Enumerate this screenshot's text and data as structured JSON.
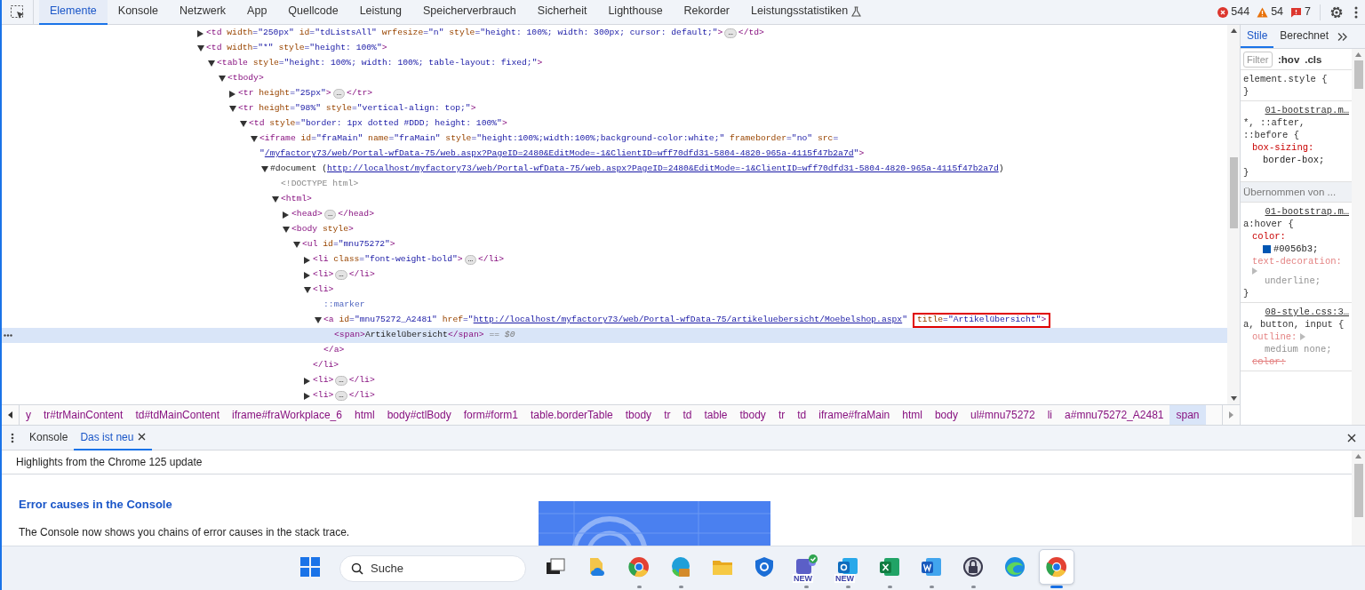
{
  "toolbar": {
    "tabs": [
      {
        "label": "Elemente",
        "selected": true,
        "experimental": false
      },
      {
        "label": "Konsole",
        "selected": false,
        "experimental": false
      },
      {
        "label": "Netzwerk",
        "selected": false,
        "experimental": false
      },
      {
        "label": "App",
        "selected": false,
        "experimental": false
      },
      {
        "label": "Quellcode",
        "selected": false,
        "experimental": false
      },
      {
        "label": "Leistung",
        "selected": false,
        "experimental": false
      },
      {
        "label": "Speicherverbrauch",
        "selected": false,
        "experimental": false
      },
      {
        "label": "Sicherheit",
        "selected": false,
        "experimental": false
      },
      {
        "label": "Lighthouse",
        "selected": false,
        "experimental": false
      },
      {
        "label": "Rekorder",
        "selected": false,
        "experimental": false
      },
      {
        "label": "Leistungsstatistiken",
        "selected": false,
        "experimental": true
      }
    ],
    "counts": [
      {
        "kind": "error",
        "text": "544"
      },
      {
        "kind": "warning",
        "text": "54"
      },
      {
        "kind": "issue",
        "text": "7"
      }
    ]
  },
  "dom_tree": {
    "nodes": [
      {
        "kind": "element",
        "expanded": false,
        "selected": false,
        "parts": [
          {
            "kind": "tag",
            "text": "<td"
          },
          {
            "kind": "attr",
            "text": " width"
          },
          {
            "kind": "value",
            "text": "=\"250px\""
          },
          {
            "kind": "attr",
            "text": " id"
          },
          {
            "kind": "value",
            "text": "=\"tdListsAll\""
          },
          {
            "kind": "attr",
            "text": " wrfesize"
          },
          {
            "kind": "value",
            "text": "=\"n\""
          },
          {
            "kind": "attr",
            "text": " style"
          },
          {
            "kind": "value",
            "text": "=\"height: 100%; width: 300px; cursor: default;\""
          },
          {
            "kind": "tag",
            "text": ">"
          },
          {
            "kind": "more",
            "text": "…"
          },
          {
            "kind": "tag",
            "text": "</td>"
          }
        ]
      },
      {
        "kind": "element",
        "expanded": true,
        "selected": false,
        "parts": [
          {
            "kind": "tag",
            "text": "<td"
          },
          {
            "kind": "attr",
            "text": " width"
          },
          {
            "kind": "value",
            "text": "=\"*\""
          },
          {
            "kind": "attr",
            "text": " style"
          },
          {
            "kind": "value",
            "text": "=\"height: 100%\""
          },
          {
            "kind": "tag",
            "text": ">"
          }
        ],
        "children": [
          {
            "kind": "element",
            "expanded": true,
            "selected": false,
            "parts": [
              {
                "kind": "tag",
                "text": "<table"
              },
              {
                "kind": "attr",
                "text": " style"
              },
              {
                "kind": "value",
                "text": "=\"height: 100%; width: 100%; table-layout: fixed;\""
              },
              {
                "kind": "tag",
                "text": ">"
              }
            ],
            "children": [
              {
                "kind": "element",
                "expanded": true,
                "selected": false,
                "parts": [
                  {
                    "kind": "tag",
                    "text": "<tbody>"
                  }
                ],
                "children": [
                  {
                    "kind": "element",
                    "expanded": false,
                    "selected": false,
                    "parts": [
                      {
                        "kind": "tag",
                        "text": "<tr"
                      },
                      {
                        "kind": "attr",
                        "text": " height"
                      },
                      {
                        "kind": "value",
                        "text": "=\"25px\""
                      },
                      {
                        "kind": "tag",
                        "text": ">"
                      },
                      {
                        "kind": "more",
                        "text": "…"
                      },
                      {
                        "kind": "tag",
                        "text": "</tr>"
                      }
                    ]
                  },
                  {
                    "kind": "element",
                    "expanded": true,
                    "selected": false,
                    "parts": [
                      {
                        "kind": "tag",
                        "text": "<tr"
                      },
                      {
                        "kind": "attr",
                        "text": " height"
                      },
                      {
                        "kind": "value",
                        "text": "=\"98%\""
                      },
                      {
                        "kind": "attr",
                        "text": " style"
                      },
                      {
                        "kind": "value",
                        "text": "=\"vertical-align: top;\""
                      },
                      {
                        "kind": "tag",
                        "text": ">"
                      }
                    ],
                    "children": [
                      {
                        "kind": "element",
                        "expanded": true,
                        "selected": false,
                        "parts": [
                          {
                            "kind": "tag",
                            "text": "<td"
                          },
                          {
                            "kind": "attr",
                            "text": " style"
                          },
                          {
                            "kind": "value",
                            "text": "=\"border: 1px dotted #DDD; height: 100%\""
                          },
                          {
                            "kind": "tag",
                            "text": ">"
                          }
                        ],
                        "children": [
                          {
                            "kind": "element",
                            "expanded": true,
                            "selected": false,
                            "parts": [
                              {
                                "kind": "tag",
                                "text": "<iframe"
                              },
                              {
                                "kind": "attr",
                                "text": " id"
                              },
                              {
                                "kind": "value",
                                "text": "=\"fraMain\""
                              },
                              {
                                "kind": "attr",
                                "text": " name"
                              },
                              {
                                "kind": "value",
                                "text": "=\"fraMain\""
                              },
                              {
                                "kind": "attr",
                                "text": " style"
                              },
                              {
                                "kind": "value",
                                "text": "=\"height:100%;width:100%;background-color:white;\""
                              },
                              {
                                "kind": "attr",
                                "text": " frameborder"
                              },
                              {
                                "kind": "value",
                                "text": "=\"no\""
                              },
                              {
                                "kind": "attr",
                                "text": " src"
                              },
                              {
                                "kind": "value",
                                "text": "="
                              }
                            ],
                            "continuation": [
                              {
                                "kind": "value",
                                "text": "\""
                              },
                              {
                                "kind": "link",
                                "text": "/myfactory73/web/Portal-wfData-75/web.aspx?PageID=2480&EditMode=-1&ClientID=wff70dfd31-5804-4820-965a-4115f47b2a7d"
                              },
                              {
                                "kind": "value",
                                "text": "\""
                              },
                              {
                                "kind": "tag",
                                "text": ">"
                              }
                            ],
                            "children": [
                              {
                                "kind": "element",
                                "expanded": true,
                                "selected": false,
                                "parts": [
                                  {
                                    "kind": "text",
                                    "text": "#document ("
                                  },
                                  {
                                    "kind": "link",
                                    "text": "http://localhost/myfactory73/web/Portal-wfData-75/web.aspx?PageID=2480&EditMode=-1&ClientID=wff70dfd31-5804-4820-965a-4115f47b2a7d"
                                  },
                                  {
                                    "kind": "text",
                                    "text": ")"
                                  }
                                ],
                                "children": [
                                  {
                                    "kind": "leaf",
                                    "expanded": false,
                                    "selected": false,
                                    "parts": [
                                      {
                                        "kind": "comment",
                                        "text": "<!DOCTYPE html>"
                                      }
                                    ]
                                  },
                                  {
                                    "kind": "element",
                                    "expanded": true,
                                    "selected": false,
                                    "parts": [
                                      {
                                        "kind": "tag",
                                        "text": "<html>"
                                      }
                                    ],
                                    "children": [
                                      {
                                        "kind": "element",
                                        "expanded": false,
                                        "selected": false,
                                        "parts": [
                                          {
                                            "kind": "tag",
                                            "text": "<head>"
                                          },
                                          {
                                            "kind": "more",
                                            "text": "…"
                                          },
                                          {
                                            "kind": "tag",
                                            "text": "</head>"
                                          }
                                        ]
                                      },
                                      {
                                        "kind": "element",
                                        "expanded": true,
                                        "selected": false,
                                        "parts": [
                                          {
                                            "kind": "tag",
                                            "text": "<body"
                                          },
                                          {
                                            "kind": "attr",
                                            "text": " style"
                                          },
                                          {
                                            "kind": "tag",
                                            "text": ">"
                                          }
                                        ],
                                        "children": [
                                          {
                                            "kind": "element",
                                            "expanded": true,
                                            "selected": false,
                                            "parts": [
                                              {
                                                "kind": "tag",
                                                "text": "<ul"
                                              },
                                              {
                                                "kind": "attr",
                                                "text": " id"
                                              },
                                              {
                                                "kind": "value",
                                                "text": "=\"mnu75272\""
                                              },
                                              {
                                                "kind": "tag",
                                                "text": ">"
                                              }
                                            ],
                                            "children": [
                                              {
                                                "kind": "element",
                                                "expanded": false,
                                                "selected": false,
                                                "parts": [
                                                  {
                                                    "kind": "tag",
                                                    "text": "<li"
                                                  },
                                                  {
                                                    "kind": "attr",
                                                    "text": " class"
                                                  },
                                                  {
                                                    "kind": "value",
                                                    "text": "=\"font-weight-bold\""
                                                  },
                                                  {
                                                    "kind": "tag",
                                                    "text": ">"
                                                  },
                                                  {
                                                    "kind": "more",
                                                    "text": "…"
                                                  },
                                                  {
                                                    "kind": "tag",
                                                    "text": "</li>"
                                                  }
                                                ]
                                              },
                                              {
                                                "kind": "element",
                                                "expanded": false,
                                                "selected": false,
                                                "parts": [
                                                  {
                                                    "kind": "tag",
                                                    "text": "<li>"
                                                  },
                                                  {
                                                    "kind": "more",
                                                    "text": "…"
                                                  },
                                                  {
                                                    "kind": "tag",
                                                    "text": "</li>"
                                                  }
                                                ]
                                              },
                                              {
                                                "kind": "element",
                                                "expanded": true,
                                                "selected": false,
                                                "parts": [
                                                  {
                                                    "kind": "tag",
                                                    "text": "<li>"
                                                  }
                                                ],
                                                "children": [
                                                  {
                                                    "kind": "leaf",
                                                    "expanded": false,
                                                    "selected": false,
                                                    "parts": [
                                                      {
                                                        "kind": "pseudo",
                                                        "text": "::marker"
                                                      }
                                                    ]
                                                  },
                                                  {
                                                    "kind": "element",
                                                    "expanded": true,
                                                    "selected": false,
                                                    "parts": [
                                                      {
                                                        "kind": "tag",
                                                        "text": "<a"
                                                      },
                                                      {
                                                        "kind": "attr",
                                                        "text": " id"
                                                      },
                                                      {
                                                        "kind": "value",
                                                        "text": "=\"mnu75272_A2481\""
                                                      },
                                                      {
                                                        "kind": "attr",
                                                        "text": " href"
                                                      },
                                                      {
                                                        "kind": "value",
                                                        "text": "=\""
                                                      },
                                                      {
                                                        "kind": "link",
                                                        "text": "http://localhost/myfactory73/web/Portal-wfData-75/artikeluebersicht/Moebelshop.aspx"
                                                      },
                                                      {
                                                        "kind": "value",
                                                        "text": "\""
                                                      }
                                                    ],
                                                    "boxed_parts": [
                                                      {
                                                        "kind": "attr",
                                                        "text": "title"
                                                      },
                                                      {
                                                        "kind": "value",
                                                        "text": "=\"Artikelübersicht\""
                                                      },
                                                      {
                                                        "kind": "tag",
                                                        "text": ">"
                                                      }
                                                    ],
                                                    "children": [
                                                      {
                                                        "kind": "leaf",
                                                        "expanded": false,
                                                        "selected": true,
                                                        "parts": [
                                                          {
                                                            "kind": "tag",
                                                            "text": "<span>"
                                                          },
                                                          {
                                                            "kind": "text",
                                                            "text": "Artikelübersicht"
                                                          },
                                                          {
                                                            "kind": "tag",
                                                            "text": "</span>"
                                                          },
                                                          {
                                                            "kind": "hint",
                                                            "text": " == $0"
                                                          }
                                                        ]
                                                      }
                                                    ],
                                                    "close": [
                                                      {
                                                        "kind": "tag",
                                                        "text": "</a>"
                                                      }
                                                    ]
                                                  }
                                                ],
                                                "close": [
                                                  {
                                                    "kind": "tag",
                                                    "text": "</li>"
                                                  }
                                                ]
                                              },
                                              {
                                                "kind": "element",
                                                "expanded": false,
                                                "selected": false,
                                                "parts": [
                                                  {
                                                    "kind": "tag",
                                                    "text": "<li>"
                                                  },
                                                  {
                                                    "kind": "more",
                                                    "text": "…"
                                                  },
                                                  {
                                                    "kind": "tag",
                                                    "text": "</li>"
                                                  }
                                                ]
                                              },
                                              {
                                                "kind": "element",
                                                "expanded": false,
                                                "selected": false,
                                                "parts": [
                                                  {
                                                    "kind": "tag",
                                                    "text": "<li>"
                                                  },
                                                  {
                                                    "kind": "more",
                                                    "text": "…"
                                                  },
                                                  {
                                                    "kind": "tag",
                                                    "text": "</li>"
                                                  }
                                                ]
                                              }
                                            ]
                                          }
                                        ]
                                      }
                                    ]
                                  }
                                ]
                              }
                            ]
                          }
                        ]
                      }
                    ]
                  }
                ]
              }
            ]
          }
        ]
      }
    ]
  },
  "breadcrumbs": [
    {
      "label": "y",
      "selected": false
    },
    {
      "label": "tr#trMainContent",
      "selected": false
    },
    {
      "label": "td#tdMainContent",
      "selected": false
    },
    {
      "label": "iframe#fraWorkplace_6",
      "selected": false
    },
    {
      "label": "html",
      "selected": false
    },
    {
      "label": "body#ctlBody",
      "selected": false
    },
    {
      "label": "form#form1",
      "selected": false
    },
    {
      "label": "table.borderTable",
      "selected": false
    },
    {
      "label": "tbody",
      "selected": false
    },
    {
      "label": "tr",
      "selected": false
    },
    {
      "label": "td",
      "selected": false
    },
    {
      "label": "table",
      "selected": false
    },
    {
      "label": "tbody",
      "selected": false
    },
    {
      "label": "tr",
      "selected": false
    },
    {
      "label": "td",
      "selected": false
    },
    {
      "label": "iframe#fraMain",
      "selected": false
    },
    {
      "label": "html",
      "selected": false
    },
    {
      "label": "body",
      "selected": false
    },
    {
      "label": "ul#mnu75272",
      "selected": false
    },
    {
      "label": "li",
      "selected": false
    },
    {
      "label": "a#mnu75272_A2481",
      "selected": false
    },
    {
      "label": "span",
      "selected": true
    }
  ],
  "styles_pane": {
    "tabs": [
      {
        "label": "Stile",
        "selected": true
      },
      {
        "label": "Berechnet",
        "selected": false
      }
    ],
    "filter_placeholder": "Filter",
    "toggles": [
      ":hov",
      ".cls"
    ],
    "rules": [
      {
        "kind": "rule",
        "selector": "element.style {",
        "close": "}"
      },
      {
        "kind": "rule",
        "source": "01-bootstrap.m…",
        "selector": "*, ::after, ::before {",
        "declarations": [
          {
            "name": "box-sizing:",
            "value": "border-box;",
            "inactive": false,
            "struck": false,
            "expandable": false
          }
        ],
        "close": "}"
      },
      {
        "kind": "header",
        "text": "Übernommen von ..."
      },
      {
        "kind": "rule",
        "source": "01-bootstrap.m…",
        "selector": "a:hover {",
        "declarations": [
          {
            "name": "color:",
            "value": "#0056b3;",
            "color": "#0056b3",
            "inactive": false,
            "struck": false,
            "expandable": false
          },
          {
            "name": "text-decoration:",
            "value": "underline;",
            "inactive": true,
            "struck": false,
            "expandable": true
          }
        ],
        "close": "}"
      },
      {
        "kind": "rule",
        "source": "08-style.css:3…",
        "selector": "a, button, input {",
        "declarations": [
          {
            "name": "outline:",
            "value": "medium none;",
            "inactive": true,
            "struck": false,
            "expandable": true
          },
          {
            "name": "color:",
            "inactive": true,
            "struck": true,
            "expandable": false
          }
        ]
      }
    ]
  },
  "drawer": {
    "tabs": [
      {
        "label": "Konsole",
        "selected": false,
        "closable": false
      },
      {
        "label": "Das ist neu",
        "selected": true,
        "closable": true
      }
    ],
    "header": "Highlights from the Chrome 125 update",
    "heading": "Error causes in the Console",
    "text": "The Console now shows you chains of error causes in the stack trace."
  },
  "taskbar": {
    "search_placeholder": "Suche",
    "apps": [
      {
        "kind": "start",
        "running": false,
        "active": false
      },
      {
        "kind": "taskview",
        "running": false,
        "active": false
      },
      {
        "kind": "cloud-files",
        "running": false,
        "active": false
      },
      {
        "kind": "browser",
        "running": true,
        "active": false
      },
      {
        "kind": "browser-work",
        "running": true,
        "active": false
      },
      {
        "kind": "folder",
        "running": false,
        "active": false
      },
      {
        "kind": "shield",
        "running": false,
        "active": false
      },
      {
        "kind": "chat",
        "running": true,
        "active": false,
        "badge": "NEW"
      },
      {
        "kind": "mail",
        "running": true,
        "active": false,
        "badge": "NEW"
      },
      {
        "kind": "sheet",
        "running": true,
        "active": false
      },
      {
        "kind": "doc",
        "running": true,
        "active": false
      },
      {
        "kind": "lock",
        "running": true,
        "active": false
      },
      {
        "kind": "wave-browser",
        "running": false,
        "active": false
      },
      {
        "kind": "browser",
        "running": true,
        "active": true
      }
    ]
  }
}
